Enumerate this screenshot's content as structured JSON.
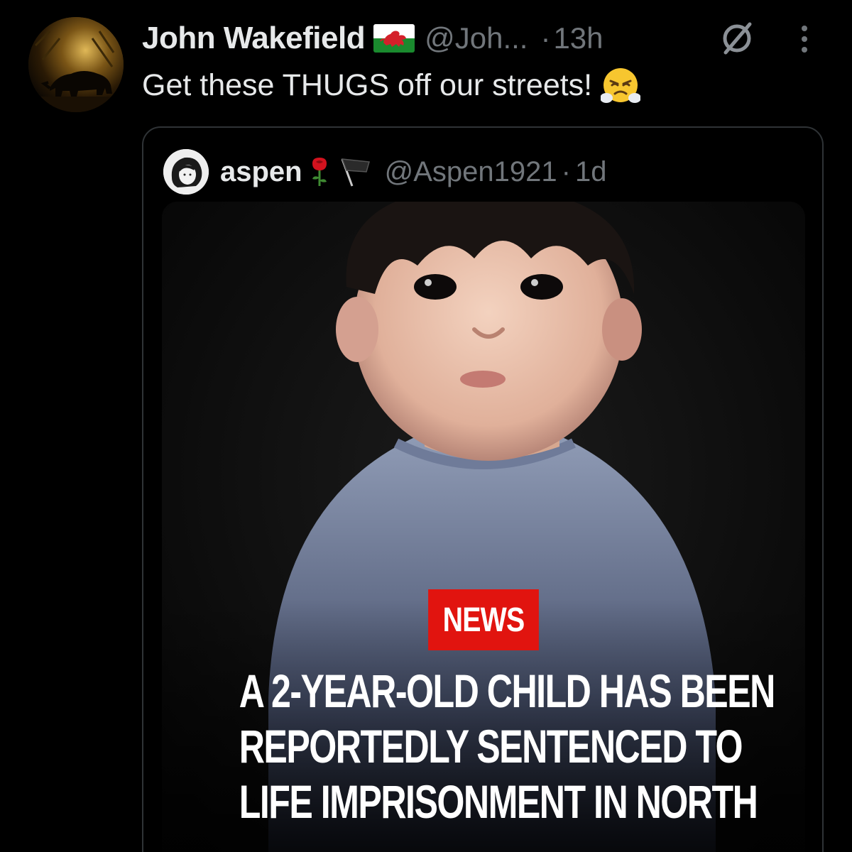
{
  "post": {
    "author_name": "John Wakefield",
    "author_handle": "@Joh...",
    "separator": "·",
    "time": "13h",
    "text": "Get these THUGS off our streets!",
    "flag_icon": "wales-flag-icon",
    "emoji_icon": "face-with-steam-from-nose-emoji"
  },
  "quote": {
    "author_name": "aspen",
    "author_handle": "@Aspen1921",
    "separator": "·",
    "time": "1d",
    "badges": [
      "rose-icon",
      "black-flag-icon"
    ],
    "media": {
      "badge_text": "NEWS",
      "headline_lines": [
        "A 2-YEAR-OLD CHILD HAS BEEN",
        "REPORTEDLY SENTENCED TO",
        "LIFE IMPRISONMENT IN NORTH"
      ]
    }
  },
  "colors": {
    "background": "#000000",
    "primary_text": "#e7e9ea",
    "secondary_text": "#71767b",
    "card_border": "#2f3336",
    "news_red": "#e1140f"
  }
}
